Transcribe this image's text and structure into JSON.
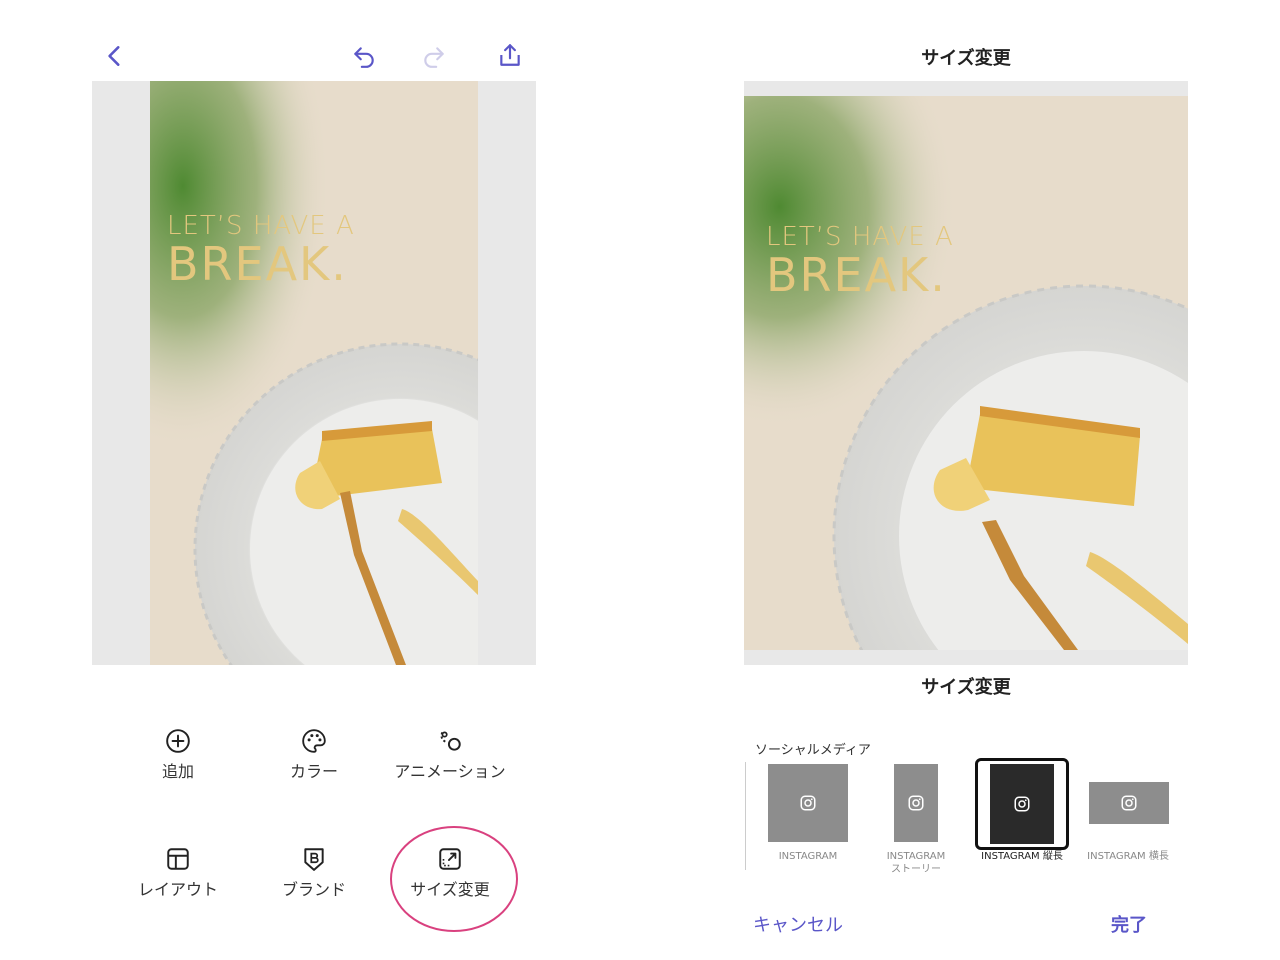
{
  "left": {
    "nav": {
      "back_icon": "chevron-left-icon",
      "undo_icon": "undo-icon",
      "redo_icon": "redo-icon",
      "share_icon": "share-icon"
    },
    "design": {
      "headline_line1": "LET’S HAVE A",
      "headline_line2": "BREAK."
    },
    "tools": [
      {
        "label": "追加",
        "icon": "plus-circle-icon"
      },
      {
        "label": "カラー",
        "icon": "palette-icon"
      },
      {
        "label": "アニメーション",
        "icon": "animation-icon"
      },
      {
        "label": "レイアウト",
        "icon": "layout-icon"
      },
      {
        "label": "ブランド",
        "icon": "brand-icon"
      },
      {
        "label": "サイズ変更",
        "icon": "resize-icon"
      }
    ]
  },
  "right": {
    "header_title": "サイズ変更",
    "design": {
      "headline_line1": "LET’S HAVE A",
      "headline_line2": "BREAK."
    },
    "sheet_title": "サイズ変更",
    "section_label": "ソーシャルメディア",
    "formats": [
      {
        "label": "INSTAGRAM",
        "icon": "instagram-icon",
        "selected": false
      },
      {
        "label": "INSTAGRAM\nストーリー",
        "icon": "instagram-icon",
        "selected": false
      },
      {
        "label": "INSTAGRAM 縦長",
        "icon": "instagram-icon",
        "selected": true
      },
      {
        "label": "INSTAGRAM 横長",
        "icon": "instagram-icon",
        "selected": false
      }
    ],
    "cancel_label": "キャンセル",
    "done_label": "完了"
  },
  "colors": {
    "accent": "#5a56c8",
    "highlight": "#d9417f",
    "headline_gold": "#e3c77e"
  }
}
